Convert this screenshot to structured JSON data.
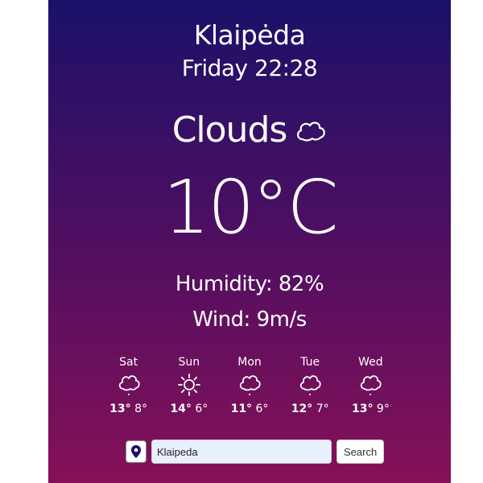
{
  "location": {
    "city": "Klaipėda",
    "datetime": "Friday 22:28"
  },
  "current": {
    "condition": "Clouds",
    "condition_icon": "cloud-icon",
    "temperature": "10°C",
    "humidity": "Humidity: 82%",
    "wind": "Wind: 9m/s"
  },
  "forecast": [
    {
      "day": "Sat",
      "icon": "cloud-icon",
      "high": "13°",
      "low": "8°"
    },
    {
      "day": "Sun",
      "icon": "sun-icon",
      "high": "14°",
      "low": "6°"
    },
    {
      "day": "Mon",
      "icon": "cloud-icon",
      "high": "11°",
      "low": "6°"
    },
    {
      "day": "Tue",
      "icon": "cloud-icon",
      "high": "12°",
      "low": "7°"
    },
    {
      "day": "Wed",
      "icon": "cloud-icon",
      "high": "13°",
      "low": "9°"
    }
  ],
  "search": {
    "value": "Klaipeda",
    "button_label": "Search",
    "location_icon": "location-pin-icon"
  },
  "colors": {
    "gradient_top": "#1b1169",
    "gradient_bottom": "#861058",
    "text": "#ffffff",
    "input_bg": "#e8f0fe"
  }
}
